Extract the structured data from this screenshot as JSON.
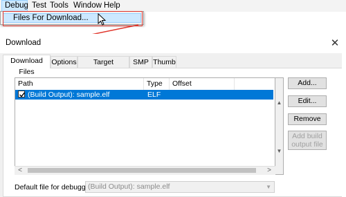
{
  "menu": {
    "items": [
      "Debug",
      "Test",
      "Tools",
      "Window",
      "Help"
    ],
    "dropdown_item": "Files For Download..."
  },
  "dialog": {
    "title": "Download",
    "close_glyph": "✕",
    "tabs": [
      "Download Files",
      "Options",
      "Target Download",
      "SMP",
      "Thumb"
    ],
    "list": {
      "columns": [
        "Path",
        "Type",
        "Offset"
      ],
      "rows": [
        {
          "path": "(Build Output): sample.elf",
          "type": "ELF",
          "offset": "",
          "checked": true,
          "selected": true
        }
      ]
    },
    "buttons": {
      "add": "Add...",
      "edit": "Edit...",
      "remove": "Remove",
      "add_build_line1": "Add build",
      "add_build_line2": "output file"
    },
    "default_file_label": "Default file for debugging",
    "default_file_value": "(Build Output): sample.elf"
  },
  "annotation_color": "#e0352b",
  "selection_color": "#0078d7"
}
